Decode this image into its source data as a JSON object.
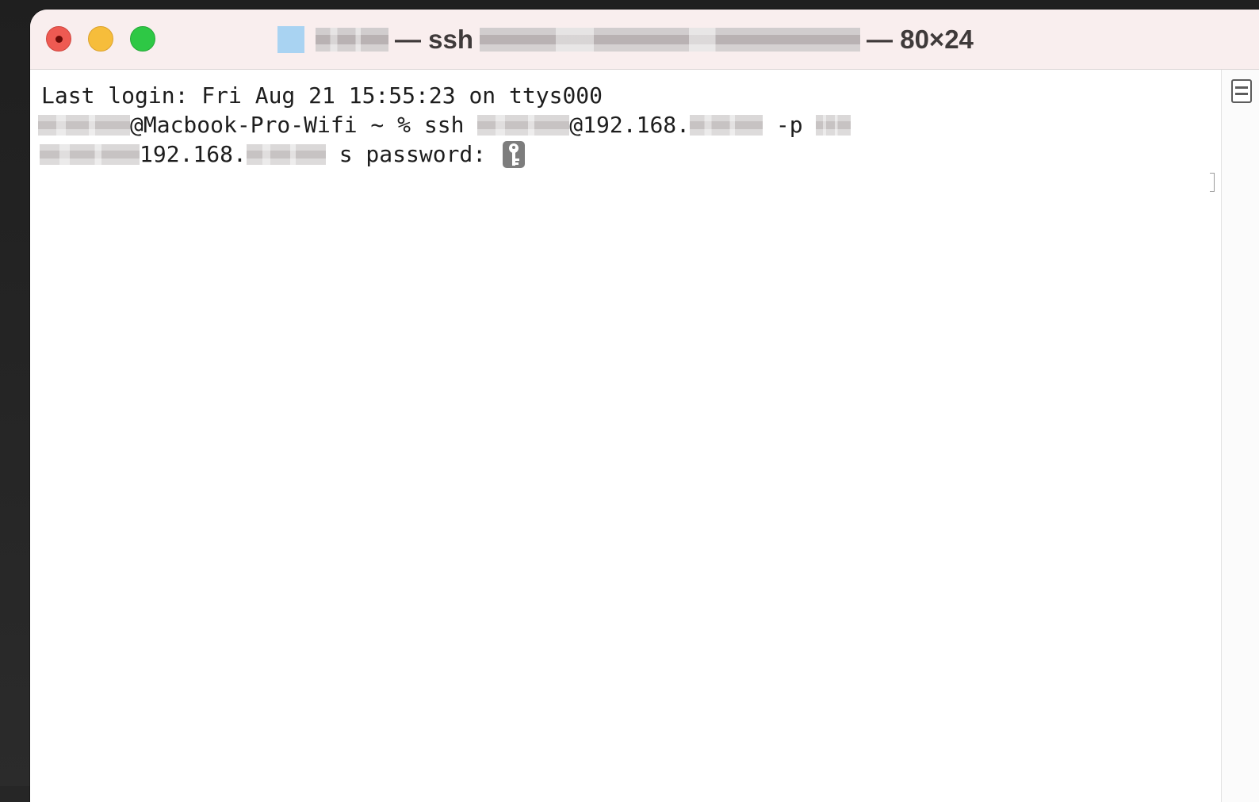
{
  "window": {
    "title_prefix_redacted": "",
    "title_mid": "— ssh",
    "title_suffix": "— 80×24"
  },
  "terminal": {
    "line1": "Last login: Fri Aug 21 15:55:23 on ttys000",
    "line2_host_prompt": "@Macbook-Pro-Wifi ~ % ssh ",
    "line2_ip_prefix": "@192.168.",
    "line2_port_flag": " -p ",
    "line3_ip_prefix": "192.168.",
    "line3_password_prompt": " s password: "
  },
  "icons": {
    "cursor": "key-icon",
    "split": "split-pane-icon"
  },
  "colors": {
    "close": "#ee5a52",
    "minimize": "#f6bd3b",
    "maximize": "#2ec845",
    "titlebar": "#f9eeee"
  }
}
